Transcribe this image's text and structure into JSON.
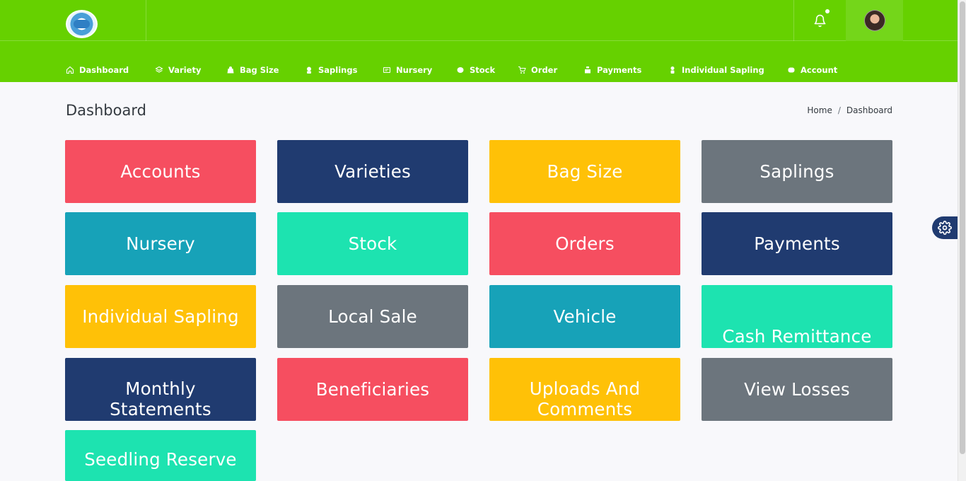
{
  "nav": {
    "items": [
      {
        "label": "Dashboard",
        "icon": "home-icon"
      },
      {
        "label": "Variety",
        "icon": "layers-icon"
      },
      {
        "label": "Bag Size",
        "icon": "bag-icon"
      },
      {
        "label": "Saplings",
        "icon": "sapling-icon"
      },
      {
        "label": "Nursery",
        "icon": "nursery-icon"
      },
      {
        "label": "Stock",
        "icon": "stock-icon"
      },
      {
        "label": "Order",
        "icon": "cart-icon"
      },
      {
        "label": "Payments",
        "icon": "payment-icon"
      },
      {
        "label": "Individual Sapling",
        "icon": "plant-icon"
      },
      {
        "label": "Account",
        "icon": "account-icon"
      }
    ]
  },
  "page": {
    "title": "Dashboard",
    "breadcrumb": {
      "home": "Home",
      "separator": "/",
      "current": "Dashboard"
    }
  },
  "tiles": [
    {
      "label": "Accounts",
      "color": "#f64e60"
    },
    {
      "label": "Varieties",
      "color": "#203b70"
    },
    {
      "label": "Bag Size",
      "color": "#ffc107"
    },
    {
      "label": "Saplings",
      "color": "#6c757d"
    },
    {
      "label": "Nursery",
      "color": "#17a2b8"
    },
    {
      "label": "Stock",
      "color": "#1de3b0"
    },
    {
      "label": "Orders",
      "color": "#f64e60"
    },
    {
      "label": "Payments",
      "color": "#203b70"
    },
    {
      "label": "Individual Sapling",
      "color": "#ffc107"
    },
    {
      "label": "Local Sale",
      "color": "#6c757d"
    },
    {
      "label": "Vehicle",
      "color": "#17a2b8"
    },
    {
      "label": "Cash Remittance",
      "color": "#1de3b0"
    },
    {
      "label": "Monthly Statements",
      "color": "#203b70"
    },
    {
      "label": "Beneficiaries",
      "color": "#f64e60"
    },
    {
      "label": "Uploads And Comments",
      "color": "#ffc107"
    },
    {
      "label": "View Losses",
      "color": "#6c757d"
    },
    {
      "label": "Seedling Reserve",
      "color": "#1de3b0"
    }
  ],
  "colors": {
    "brand_green": "#66d100",
    "accent_navy": "#203b70"
  }
}
